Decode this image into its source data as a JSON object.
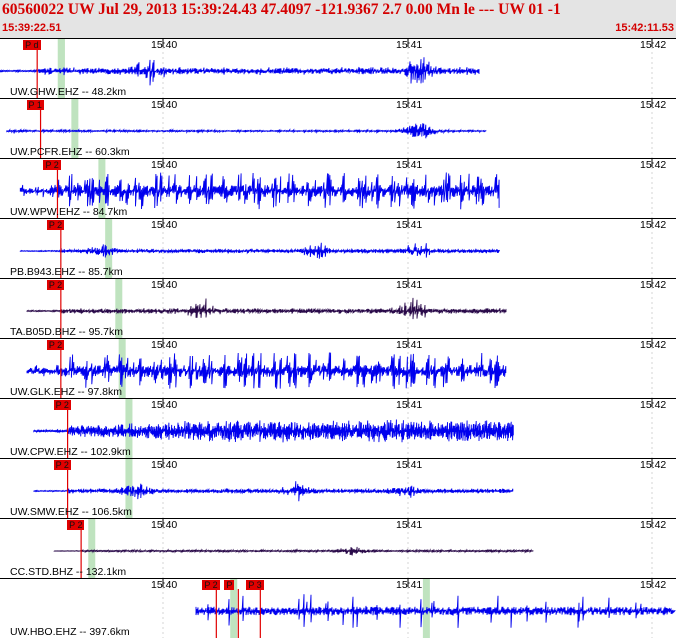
{
  "header": {
    "title": "60560022 UW Jul 29, 2013 15:39:24.43   47.4097 -121.9367  2.7 0.00 Mn le --- UW 01  -1",
    "start_time": "15:39:22.51",
    "end_time": "15:42:11.53"
  },
  "tick_labels": [
    "15:40",
    "15:41",
    "15:42"
  ],
  "colors": {
    "wave_blue": "#0000ee",
    "wave_dark": "#2a0a4a",
    "pick": "#e00000",
    "window": "#bfe3bf",
    "header_text": "#d40000"
  },
  "panels": [
    {
      "label": "UW.GHW.EHZ -- 48.2km",
      "picks": [
        "P d"
      ],
      "color_key": "wave_blue",
      "style": "event",
      "start": 0.0,
      "end": 0.71,
      "amp": 0.4,
      "burst": [
        0.22,
        0.62
      ],
      "pick_at": 0.055,
      "green_at": [
        0.09,
        0.09
      ]
    },
    {
      "label": "UW.PCFR.EHZ -- 60.3km",
      "picks": [
        "P 1"
      ],
      "color_key": "wave_blue",
      "style": "quiet",
      "start": 0.01,
      "end": 0.72,
      "amp": 0.08,
      "burst": [
        0.62
      ],
      "pick_at": 0.06,
      "green_at": [
        0.11
      ]
    },
    {
      "label": "UW.WPW.EHZ -- 84.7km",
      "picks": [
        "P 2"
      ],
      "color_key": "wave_blue",
      "style": "clip",
      "start": 0.03,
      "end": 0.74,
      "amp": 0.55,
      "burst": [],
      "pick_at": 0.085,
      "green_at": [
        0.15
      ]
    },
    {
      "label": "PB.B943.EHZ -- 85.7km",
      "picks": [
        "P 2"
      ],
      "color_key": "wave_blue",
      "style": "noisy",
      "start": 0.03,
      "end": 0.74,
      "amp": 0.22,
      "burst": [
        0.15,
        0.47,
        0.62
      ],
      "pick_at": 0.09,
      "green_at": [
        0.16
      ]
    },
    {
      "label": "TA.B05D.BHZ -- 95.7km",
      "picks": [
        "P 2"
      ],
      "color_key": "wave_dark",
      "style": "event",
      "start": 0.04,
      "end": 0.75,
      "amp": 0.3,
      "burst": [
        0.3,
        0.61
      ],
      "pick_at": 0.09,
      "green_at": [
        0.175
      ]
    },
    {
      "label": "UW.GLK.EHZ -- 97.8km",
      "picks": [
        "P 2"
      ],
      "color_key": "wave_blue",
      "style": "clip",
      "start": 0.04,
      "end": 0.75,
      "amp": 0.55,
      "burst": [],
      "pick_at": 0.09,
      "green_at": [
        0.18
      ]
    },
    {
      "label": "UW.CPW.EHZ -- 102.9km",
      "picks": [
        "P 2"
      ],
      "color_key": "wave_blue",
      "style": "dense",
      "start": 0.05,
      "end": 0.76,
      "amp": 0.4,
      "burst": [],
      "pick_at": 0.1,
      "green_at": [
        0.19
      ]
    },
    {
      "label": "UW.SMW.EHZ -- 106.5km",
      "picks": [
        "P 2"
      ],
      "color_key": "wave_blue",
      "style": "noisy",
      "start": 0.05,
      "end": 0.76,
      "amp": 0.25,
      "burst": [
        0.2,
        0.44,
        0.6
      ],
      "pick_at": 0.1,
      "green_at": [
        0.19
      ]
    },
    {
      "label": "CC.STD.BHZ -- 132.1km",
      "picks": [
        "P 2"
      ],
      "color_key": "wave_dark",
      "style": "event",
      "start": 0.08,
      "end": 0.79,
      "amp": 0.12,
      "burst": [
        0.52
      ],
      "pick_at": 0.12,
      "green_at": [
        0.135
      ]
    },
    {
      "label": "UW.HBO.EHZ -- 397.6km",
      "picks": [
        "P 2",
        "P",
        "P 3"
      ],
      "color_key": "wave_blue",
      "style": "spiky",
      "start": 0.29,
      "end": 1.0,
      "amp": 0.5,
      "burst": [],
      "pick_at": 0.32,
      "green_at": [
        0.345,
        0.63
      ]
    }
  ]
}
